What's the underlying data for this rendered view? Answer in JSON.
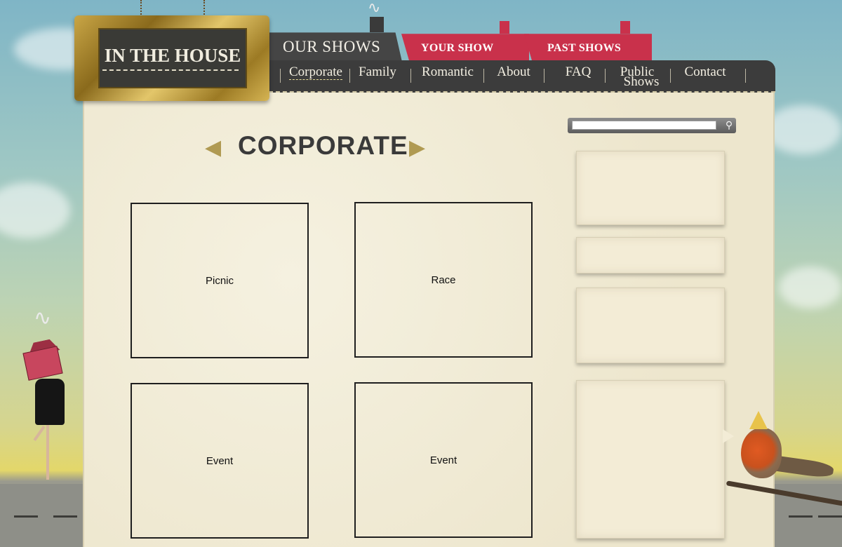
{
  "logo": {
    "text": "IN THE HOUSE"
  },
  "header": {
    "our_shows": "OUR SHOWS",
    "tabs": [
      {
        "label": "YOUR SHOW"
      },
      {
        "label": "PAST SHOWS"
      }
    ]
  },
  "nav": {
    "items": [
      {
        "label": "Corporate",
        "active": true
      },
      {
        "label": "Family"
      },
      {
        "label": "Romantic"
      },
      {
        "label": "About"
      },
      {
        "label": "FAQ"
      },
      {
        "label": "Public Shows",
        "line1": "Public",
        "line2": "Shows"
      },
      {
        "label": "Contact"
      }
    ]
  },
  "page": {
    "title": "CORPORATE"
  },
  "tiles": [
    {
      "label": "Picnic"
    },
    {
      "label": "Race"
    },
    {
      "label": "Event"
    },
    {
      "label": "Event"
    }
  ],
  "search": {
    "value": "",
    "button_icon": "search-icon"
  },
  "colors": {
    "accent_red": "#c9314b",
    "nav_dark": "#3c3c3c",
    "panel": "#f1ecd8",
    "arrow_gold": "#b09a52"
  }
}
